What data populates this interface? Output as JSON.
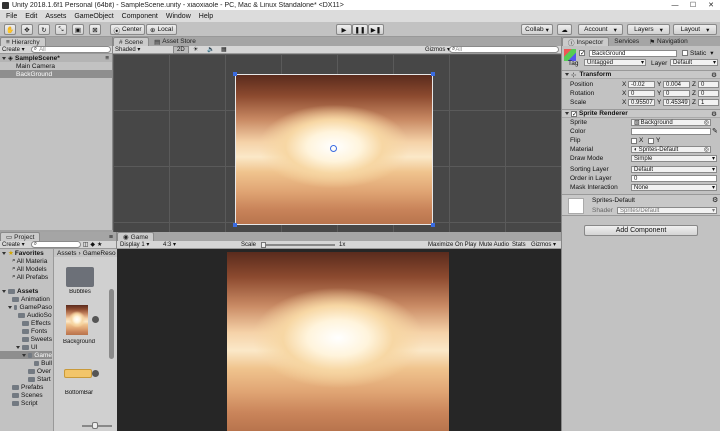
{
  "window": {
    "title": "Unity 2018.1.6f1 Personal (64bit) - SampleScene.unity - xiaoxiaole - PC, Mac & Linux Standalone* <DX11>"
  },
  "menu": [
    "File",
    "Edit",
    "Assets",
    "GameObject",
    "Component",
    "Window",
    "Help"
  ],
  "toolbar": {
    "center": "Center",
    "local": "Local",
    "collab": "Collab",
    "account": "Account",
    "layers": "Layers",
    "layout": "Layout"
  },
  "hierarchy": {
    "tab": "Hierarchy",
    "create": "Create",
    "search_placeholder": "All",
    "scene": "SampleScene*",
    "items": [
      "Main Camera",
      "BackGround"
    ]
  },
  "scene": {
    "tabs": [
      "Scene",
      "Asset Store"
    ],
    "shading": "Shaded",
    "mode2d": "2D",
    "gizmos": "Gizmos",
    "search_placeholder": "All"
  },
  "game": {
    "tab": "Game",
    "display": "Display 1",
    "aspect": "4:3",
    "scale_label": "Scale",
    "scale_value": "1x",
    "maximize": "Maximize On Play",
    "mute": "Mute Audio",
    "stats": "Stats",
    "gizmos": "Gizmos"
  },
  "project": {
    "tab": "Project",
    "create": "Create",
    "favorites": "Favorites",
    "fav_items": [
      "All Materia",
      "All Models",
      "All Prefabs"
    ],
    "assets": "Assets",
    "tree": [
      "Animation",
      "GamePaso",
      "AudioSo",
      "Effects",
      "Fonts",
      "Sweets",
      "UI",
      "Game",
      "Bull",
      "Over",
      "Start",
      "Prefabs",
      "Scenes",
      "Script"
    ],
    "breadcrumb": [
      "Assets",
      "GameReso"
    ],
    "grid": [
      {
        "label": "Bubbles"
      },
      {
        "label": "Background"
      },
      {
        "label": "BottomBar"
      }
    ]
  },
  "inspector": {
    "tabs": [
      "Inspector",
      "Services",
      "Navigation"
    ],
    "object_name": "BackGround",
    "static_label": "Static",
    "tag_label": "Tag",
    "tag_value": "Untagged",
    "layer_label": "Layer",
    "layer_value": "Default",
    "transform": {
      "title": "Transform",
      "rows": [
        {
          "label": "Position",
          "x": "-0.02",
          "y": "0.004",
          "z": "0"
        },
        {
          "label": "Rotation",
          "x": "0",
          "y": "0",
          "z": "0"
        },
        {
          "label": "Scale",
          "x": "0.95507",
          "y": "0.45349",
          "z": "1"
        }
      ]
    },
    "sprite_renderer": {
      "title": "Sprite Renderer",
      "sprite_label": "Sprite",
      "sprite_value": "Background",
      "color_label": "Color",
      "flip_label": "Flip",
      "flip_x": "X",
      "flip_y": "Y",
      "material_label": "Material",
      "material_value": "Sprites-Default",
      "draw_mode_label": "Draw Mode",
      "draw_mode_value": "Simple",
      "sorting_layer_label": "Sorting Layer",
      "sorting_layer_value": "Default",
      "order_label": "Order in Layer",
      "order_value": "0",
      "mask_label": "Mask Interaction",
      "mask_value": "None"
    },
    "material": {
      "name": "Sprites-Default",
      "shader_label": "Shader",
      "shader_value": "Sprites/Default"
    },
    "add_component": "Add Component"
  }
}
